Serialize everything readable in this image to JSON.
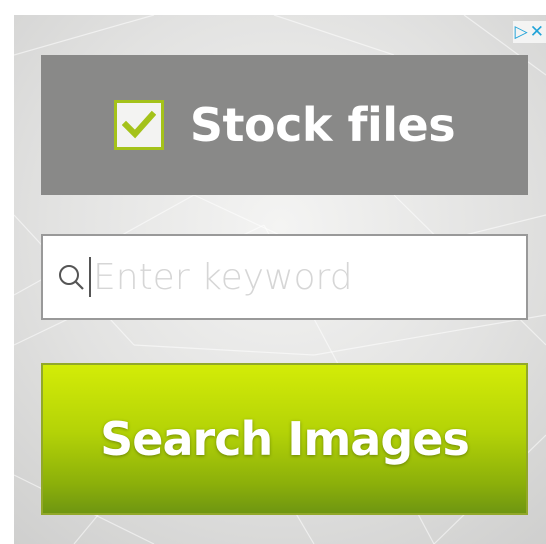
{
  "ad": {
    "adchoices_icon": "adchoices-triangle-icon",
    "close_icon": "close-icon",
    "adchoices_glyph": "▷",
    "close_glyph": "✕",
    "banner": {
      "checkbox_icon": "check-icon",
      "title": "Stock files"
    },
    "search": {
      "icon": "search-icon",
      "placeholder": "Enter keyword",
      "value": ""
    },
    "button": {
      "label": "Search Images"
    },
    "colors": {
      "accent_green": "#b4d307",
      "banner_gray": "#898988",
      "adchoices_blue": "#21a3d8"
    }
  }
}
